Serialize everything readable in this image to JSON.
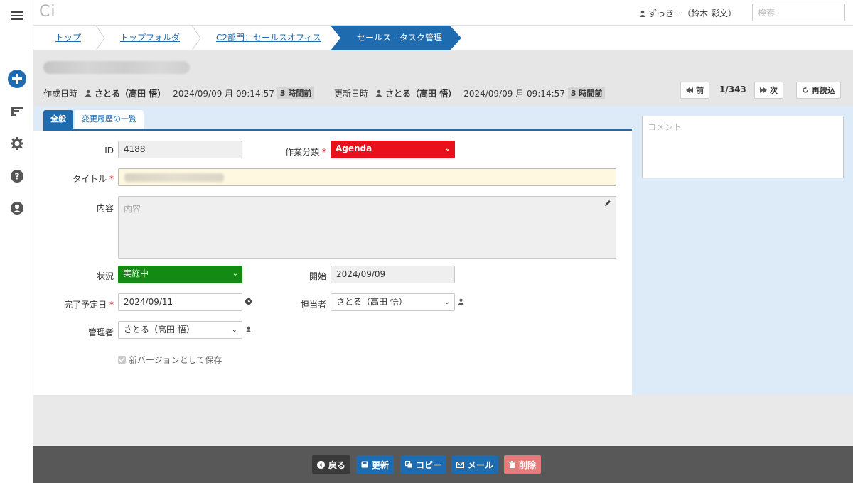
{
  "app": {
    "logo": "Ci"
  },
  "header": {
    "user_name": "ずっきー（鈴木 彩文）",
    "search_placeholder": "検索"
  },
  "breadcrumb": [
    {
      "label": "トップ"
    },
    {
      "label": "トップフォルダ"
    },
    {
      "label": "C2部門：セールスオフィス"
    },
    {
      "label": "セールス - タスク管理"
    }
  ],
  "record": {
    "created_label": "作成日時",
    "created_user": "さとる（高田 悟）",
    "created_at": "2024/09/09 月 09:14:57",
    "created_ago": "3 時間前",
    "updated_label": "更新日時",
    "updated_user": "さとる（高田 悟）",
    "updated_at": "2024/09/09 月 09:14:57",
    "updated_ago": "3 時間前",
    "prev_label": "前",
    "counter": "1/343",
    "next_label": "次",
    "reload_label": "再読込"
  },
  "tabs": [
    {
      "label": "全般",
      "active": true
    },
    {
      "label": "変更履歴の一覧",
      "active": false
    }
  ],
  "form": {
    "id_label": "ID",
    "id_value": "4188",
    "category_label": "作業分類",
    "category_value": "Agenda",
    "title_label": "タイトル",
    "content_label": "内容",
    "content_placeholder": "内容",
    "status_label": "状況",
    "status_value": "実施中",
    "start_label": "開始",
    "start_value": "2024/09/09",
    "due_label": "完了予定日",
    "due_value": "2024/09/11",
    "assignee_label": "担当者",
    "assignee_value": "さとる（高田 悟）",
    "manager_label": "管理者",
    "manager_value": "さとる（高田 悟）",
    "new_version_label": "新バージョンとして保存",
    "comment_placeholder": "コメント"
  },
  "footer": {
    "back_label": "戻る",
    "update_label": "更新",
    "copy_label": "コピー",
    "mail_label": "メール",
    "delete_label": "削除"
  },
  "colors": {
    "accent": "#1f6bb0",
    "category_bg": "#e8101a",
    "status_bg": "#138a13",
    "delete_bg": "#e57b7b",
    "title_bg": "#fff8e1"
  }
}
